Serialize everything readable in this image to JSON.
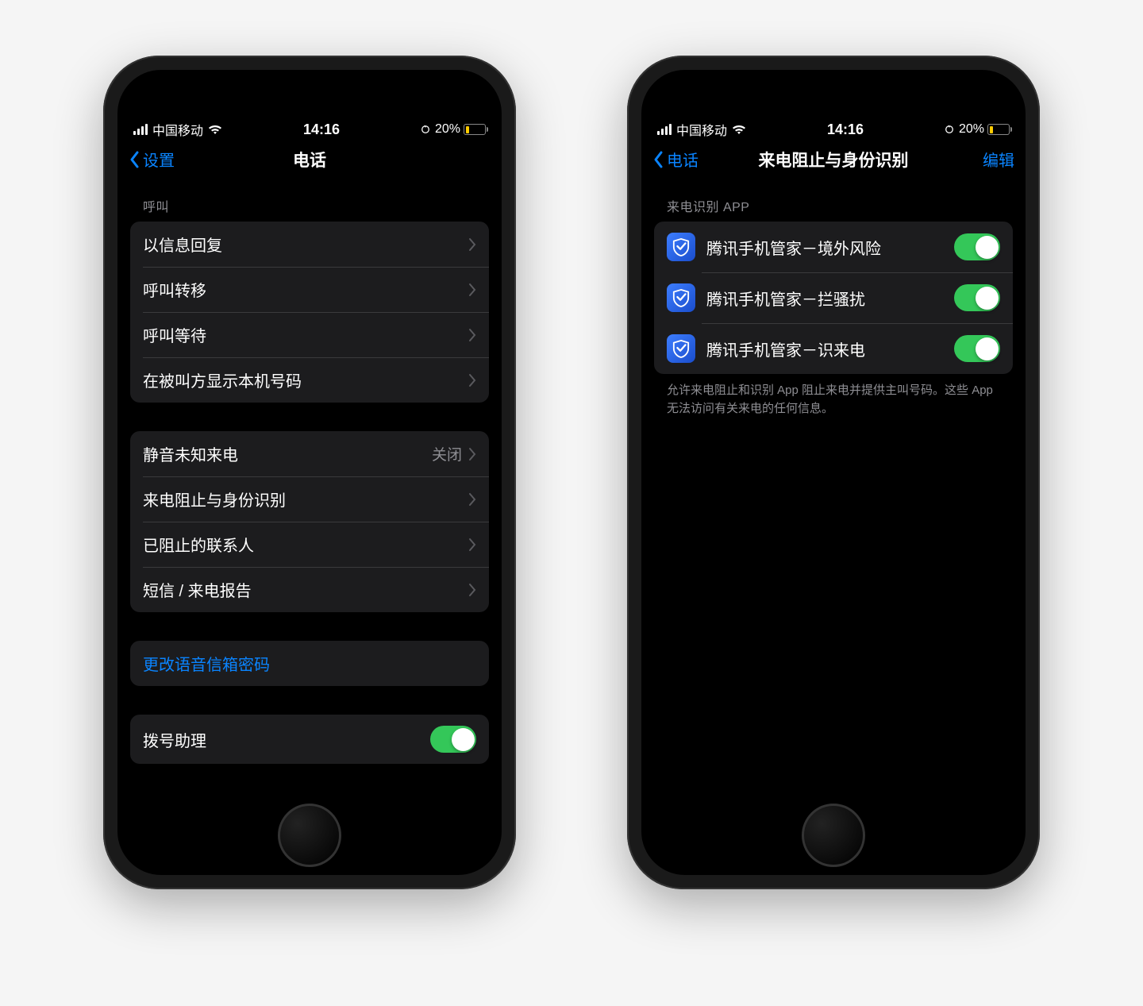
{
  "status": {
    "carrier": "中国移动",
    "time": "14:16",
    "battery_pct": "20%"
  },
  "left_screen": {
    "back": "设置",
    "title": "电话",
    "section_call": "呼叫",
    "items_call": [
      "以信息回复",
      "呼叫转移",
      "呼叫等待",
      "在被叫方显示本机号码"
    ],
    "items_block": {
      "silence_label": "静音未知来电",
      "silence_value": "关闭",
      "call_block": "来电阻止与身份识别",
      "blocked_contacts": "已阻止的联系人",
      "sms_report": "短信 / 来电报告"
    },
    "voicemail": "更改语音信箱密码",
    "dial_assist": "拨号助理"
  },
  "right_screen": {
    "back": "电话",
    "title": "来电阻止与身份识别",
    "edit": "编辑",
    "section": "来电识别 APP",
    "apps": [
      "腾讯手机管家－境外风险",
      "腾讯手机管家－拦骚扰",
      "腾讯手机管家－识来电"
    ],
    "footer": "允许来电阻止和识别 App 阻止来电并提供主叫号码。这些 App 无法访问有关来电的任何信息。"
  }
}
